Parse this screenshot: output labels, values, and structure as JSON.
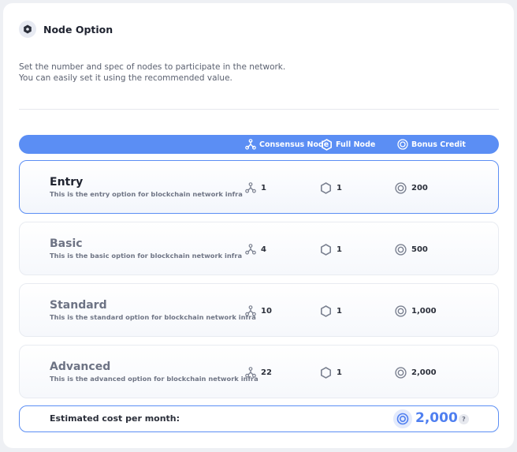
{
  "header": {
    "title": "Node Option",
    "icon": "node-gear-icon"
  },
  "description": {
    "line1": "Set the number and spec of nodes to participate in the network.",
    "line2": "You can easily set it using the recommended value."
  },
  "table": {
    "columns": {
      "consensus": "Consensus Node",
      "full": "Full Node",
      "bonus": "Bonus Credit"
    },
    "rows": [
      {
        "name": "Entry",
        "description": "This is the entry option for blockchain network infra",
        "consensus": "1",
        "full": "1",
        "bonus": "200",
        "selected": true
      },
      {
        "name": "Basic",
        "description": "This is the basic option for blockchain network infra",
        "consensus": "4",
        "full": "1",
        "bonus": "500",
        "selected": false
      },
      {
        "name": "Standard",
        "description": "This is the standard option for blockchain network infra",
        "consensus": "10",
        "full": "1",
        "bonus": "1,000",
        "selected": false
      },
      {
        "name": "Advanced",
        "description": "This is the advanced option for blockchain network infra",
        "consensus": "22",
        "full": "1",
        "bonus": "2,000",
        "selected": false
      }
    ]
  },
  "cost": {
    "label": "Estimated cost per month:",
    "value": "2,000",
    "help": "?"
  },
  "colors": {
    "accent": "#5b8ef4",
    "accent_text": "#4f7ff0"
  }
}
